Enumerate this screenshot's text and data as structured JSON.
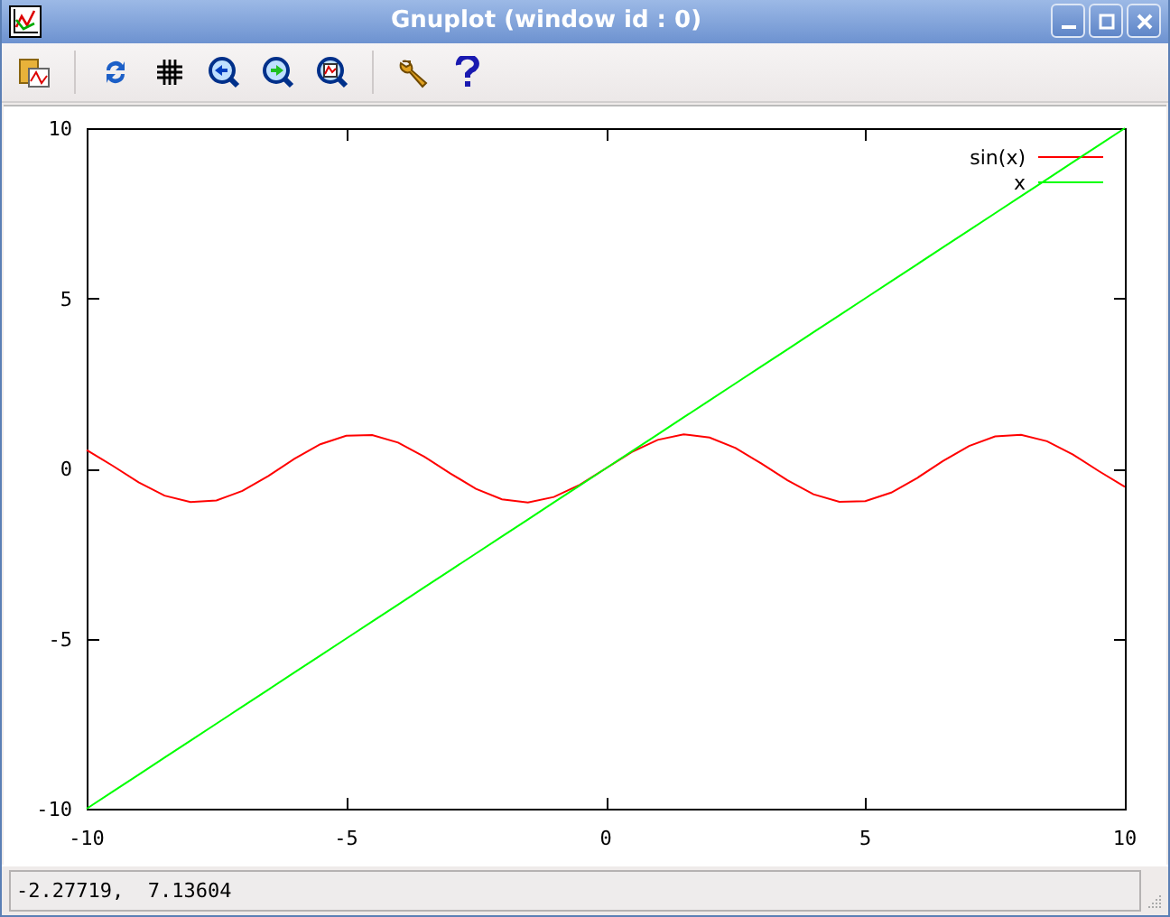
{
  "window": {
    "title": "Gnuplot (window id : 0)"
  },
  "plot": {
    "chart_data": {
      "type": "line",
      "x": [
        -10,
        -9.5,
        -9,
        -8.5,
        -8,
        -7.5,
        -7,
        -6.5,
        -6,
        -5.5,
        -5,
        -4.5,
        -4,
        -3.5,
        -3,
        -2.5,
        -2,
        -1.5,
        -1,
        -0.5,
        0,
        0.5,
        1,
        1.5,
        2,
        2.5,
        3,
        3.5,
        4,
        4.5,
        5,
        5.5,
        6,
        6.5,
        7,
        7.5,
        8,
        8.5,
        9,
        9.5,
        10
      ],
      "series": [
        {
          "name": "sin(x)",
          "color": "#ff0000",
          "values": [
            0.54,
            0.08,
            -0.41,
            -0.8,
            -0.99,
            -0.94,
            -0.66,
            -0.22,
            0.28,
            0.71,
            0.96,
            0.98,
            0.76,
            0.35,
            -0.14,
            -0.6,
            -0.91,
            -1,
            -0.84,
            -0.48,
            0,
            0.48,
            0.84,
            1,
            0.91,
            0.6,
            0.14,
            -0.35,
            -0.76,
            -0.98,
            -0.96,
            -0.71,
            -0.28,
            0.22,
            0.66,
            0.94,
            0.99,
            0.8,
            0.41,
            -0.08,
            -0.54
          ]
        },
        {
          "name": "x",
          "color": "#00ff00",
          "values": [
            -10,
            -9.5,
            -9,
            -8.5,
            -8,
            -7.5,
            -7,
            -6.5,
            -6,
            -5.5,
            -5,
            -4.5,
            -4,
            -3.5,
            -3,
            -2.5,
            -2,
            -1.5,
            -1,
            -0.5,
            0,
            0.5,
            1,
            1.5,
            2,
            2.5,
            3,
            3.5,
            4,
            4.5,
            5,
            5.5,
            6,
            6.5,
            7,
            7.5,
            8,
            8.5,
            9,
            9.5,
            10
          ]
        }
      ],
      "xlim": [
        -10,
        10
      ],
      "ylim": [
        -10,
        10
      ],
      "xticks": [
        -10,
        -5,
        0,
        5,
        10
      ],
      "yticks": [
        -10,
        -5,
        0,
        5,
        10
      ],
      "legend": true
    }
  },
  "status_bar": {
    "text": "-2.27719,  7.13604"
  }
}
